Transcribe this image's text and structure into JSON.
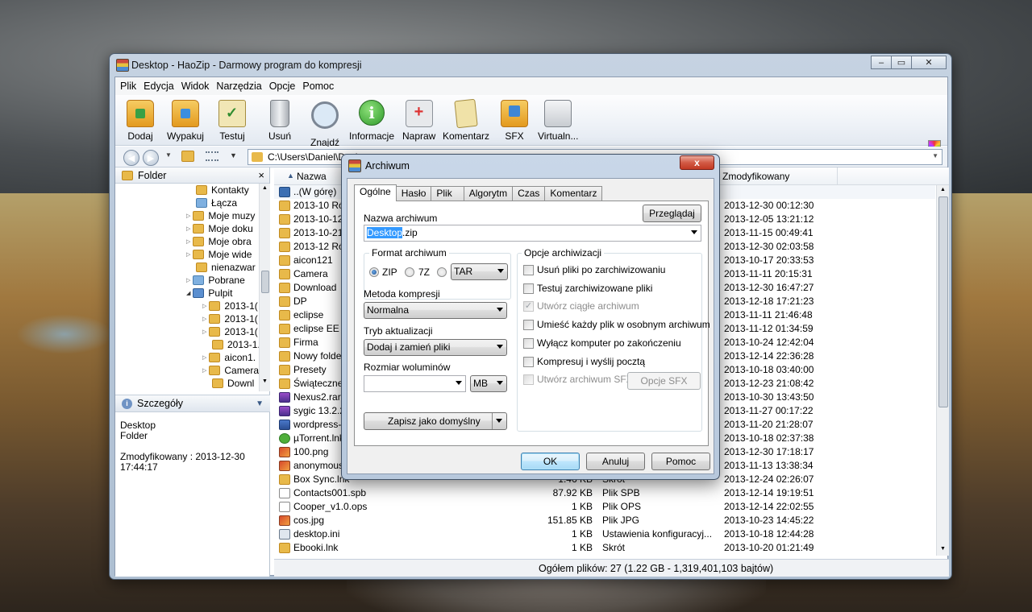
{
  "window": {
    "title": "Desktop - HaoZip - Darmowy program do kompresji",
    "caption_minimize": "–",
    "caption_maximize": "▭",
    "caption_close": "✕"
  },
  "menu": [
    "Plik",
    "Edycja",
    "Widok",
    "Narzędzia",
    "Opcje",
    "Pomoc"
  ],
  "toolbar": [
    {
      "label": "Dodaj",
      "icon": "add-archive-icon"
    },
    {
      "label": "Wypakuj",
      "icon": "extract-icon"
    },
    {
      "label": "Testuj",
      "icon": "test-icon"
    },
    {
      "label": "Usuń",
      "icon": "delete-icon"
    },
    {
      "label": "Znajdź",
      "icon": "find-icon"
    },
    {
      "label": "Informacje",
      "icon": "info-icon"
    },
    {
      "label": "Napraw",
      "icon": "repair-icon"
    },
    {
      "label": "Komentarz",
      "icon": "comment-icon"
    },
    {
      "label": "SFX",
      "icon": "sfx-icon"
    },
    {
      "label": "Virtualn...",
      "icon": "virtual-printer-icon"
    }
  ],
  "address": {
    "path": "C:\\Users\\Daniel\\Desk"
  },
  "left_pane": {
    "title": "Folder",
    "close": "×",
    "tree": [
      "Kontakty",
      "Łącza",
      "Moje muzy",
      "Moje doku",
      "Moje obra",
      "Moje wide",
      "nienazwar",
      "Pobrane",
      "Pulpit",
      "2013-1(",
      "2013-1(",
      "2013-1(",
      "2013-1.",
      "aicon1.",
      "Camera",
      "Downl"
    ],
    "scroll_grip": "|||"
  },
  "details": {
    "title": "Szczegóły",
    "name": "Desktop",
    "type": "Folder",
    "modified_label": "Zmodyfikowany : 2013-12-30",
    "modified_time": "17:44:17"
  },
  "columns": {
    "name": "Nazwa",
    "modified": "Zmodyfikowany"
  },
  "files": [
    {
      "name": "..(W górę)",
      "size": "",
      "type": "",
      "modified": "",
      "icon": "up-icon"
    },
    {
      "name": "2013-10 Róż",
      "size": "",
      "type": "",
      "modified": "2013-12-30 00:12:30",
      "icon": "folder-icon"
    },
    {
      "name": "2013-10-12 k",
      "size": "",
      "type": "",
      "modified": "2013-12-05 13:21:12",
      "icon": "folder-icon"
    },
    {
      "name": "2013-10-21 T",
      "size": "",
      "type": "",
      "modified": "2013-11-15 00:49:41",
      "icon": "folder-icon"
    },
    {
      "name": "2013-12 Róż",
      "size": "",
      "type": "",
      "modified": "2013-12-30 02:03:58",
      "icon": "folder-icon"
    },
    {
      "name": "aicon121",
      "size": "",
      "type": "",
      "modified": "2013-10-17 20:33:53",
      "icon": "folder-icon"
    },
    {
      "name": "Camera",
      "size": "",
      "type": "",
      "modified": "2013-11-11 20:15:31",
      "icon": "folder-icon"
    },
    {
      "name": "Download",
      "size": "",
      "type": "",
      "modified": "2013-12-30 16:47:27",
      "icon": "folder-icon"
    },
    {
      "name": "DP",
      "size": "",
      "type": "",
      "modified": "2013-12-18 17:21:23",
      "icon": "folder-icon"
    },
    {
      "name": "eclipse",
      "size": "",
      "type": "",
      "modified": "2013-11-11 21:46:48",
      "icon": "folder-icon"
    },
    {
      "name": "eclipse EE",
      "size": "",
      "type": "",
      "modified": "2013-11-12 01:34:59",
      "icon": "folder-icon"
    },
    {
      "name": "Firma",
      "size": "",
      "type": "",
      "modified": "2013-10-24 12:42:04",
      "icon": "folder-icon"
    },
    {
      "name": "Nowy folder",
      "size": "",
      "type": "",
      "modified": "2013-12-14 22:36:28",
      "icon": "folder-icon"
    },
    {
      "name": "Presety",
      "size": "",
      "type": "",
      "modified": "2013-10-18 03:40:00",
      "icon": "folder-icon"
    },
    {
      "name": "Świąteczne",
      "size": "",
      "type": "",
      "modified": "2013-12-23 21:08:42",
      "icon": "folder-icon"
    },
    {
      "name": "Nexus2.rar",
      "size": "",
      "type": "",
      "modified": "2013-10-30 13:43:50",
      "icon": "rar-icon"
    },
    {
      "name": "sygic 13.2.2",
      "size": "",
      "type": "",
      "modified": "2013-11-27 00:17:22",
      "icon": "rar-icon"
    },
    {
      "name": "wordpress-3",
      "size": "",
      "type": "",
      "modified": "2013-11-20 21:28:07",
      "icon": "zip-icon"
    },
    {
      "name": "µTorrent.lnk",
      "size": "",
      "type": "",
      "modified": "2013-10-18 02:37:38",
      "icon": "utorrent-icon"
    },
    {
      "name": "100.png",
      "size": "",
      "type": "",
      "modified": "2013-12-30 17:18:17",
      "icon": "image-icon"
    },
    {
      "name": "anonymousp",
      "size": "",
      "type": "",
      "modified": "2013-11-13 13:38:34",
      "icon": "image-icon"
    },
    {
      "name": "Box Sync.lnk",
      "size": "1.46 KB",
      "type": "Skrót",
      "modified": "2013-12-24 02:26:07",
      "icon": "shortcut-icon"
    },
    {
      "name": "Contacts001.spb",
      "size": "87.92 KB",
      "type": "Plik SPB",
      "modified": "2013-12-14 19:19:51",
      "icon": "file-icon"
    },
    {
      "name": "Cooper_v1.0.ops",
      "size": "1 KB",
      "type": "Plik OPS",
      "modified": "2013-12-14 22:02:55",
      "icon": "file-icon"
    },
    {
      "name": "cos.jpg",
      "size": "151.85 KB",
      "type": "Plik JPG",
      "modified": "2013-10-23 14:45:22",
      "icon": "image-icon"
    },
    {
      "name": "desktop.ini",
      "size": "1 KB",
      "type": "Ustawienia konfiguracyj...",
      "modified": "2013-10-18 12:44:28",
      "icon": "settings-file-icon"
    },
    {
      "name": "Ebooki.lnk",
      "size": "1 KB",
      "type": "Skrót",
      "modified": "2013-10-20 01:21:49",
      "icon": "shortcut-icon"
    }
  ],
  "status": "Ogółem plików: 27 (1.22 GB - 1,319,401,103 bajtów)",
  "dialog": {
    "title": "Archiwum",
    "close": "x",
    "tabs": [
      "Ogólne",
      "Hasło",
      "Plik",
      "Algorytm",
      "Czas",
      "Komentarz"
    ],
    "archive_name_label": "Nazwa archiwum",
    "browse_button": "Przeglądaj",
    "archive_name_selected": "Desktop",
    "archive_name_rest": ".zip",
    "format_group": "Format archiwum",
    "formats": [
      "ZIP",
      "7Z"
    ],
    "format_selected": "ZIP",
    "format_combo": "TAR",
    "method_label": "Metoda kompresji",
    "method_value": "Normalna",
    "update_label": "Tryb aktualizacji",
    "update_value": "Dodaj i zamień pliki",
    "volume_label": "Rozmiar woluminów",
    "volume_value": "",
    "volume_unit": "MB",
    "save_default_button": "Zapisz jako domyślny",
    "options_group": "Opcje archiwizacji",
    "options": [
      {
        "label": "Usuń pliki po zarchiwizowaniu",
        "checked": false,
        "disabled": false
      },
      {
        "label": "Testuj zarchiwizowane pliki",
        "checked": false,
        "disabled": false
      },
      {
        "label": "Utwórz ciągłe archiwum",
        "checked": true,
        "disabled": true
      },
      {
        "label": "Umieść każdy plik w osobnym archiwum",
        "checked": false,
        "disabled": false
      },
      {
        "label": "Wyłącz komputer po zakończeniu",
        "checked": false,
        "disabled": false
      },
      {
        "label": "Kompresuj i wyślij pocztą",
        "checked": false,
        "disabled": false
      },
      {
        "label": "Utwórz archiwum SFX",
        "checked": false,
        "disabled": true
      }
    ],
    "sfx_options_button": "Opcje SFX",
    "ok_button": "OK",
    "cancel_button": "Anuluj",
    "help_button": "Pomoc"
  }
}
